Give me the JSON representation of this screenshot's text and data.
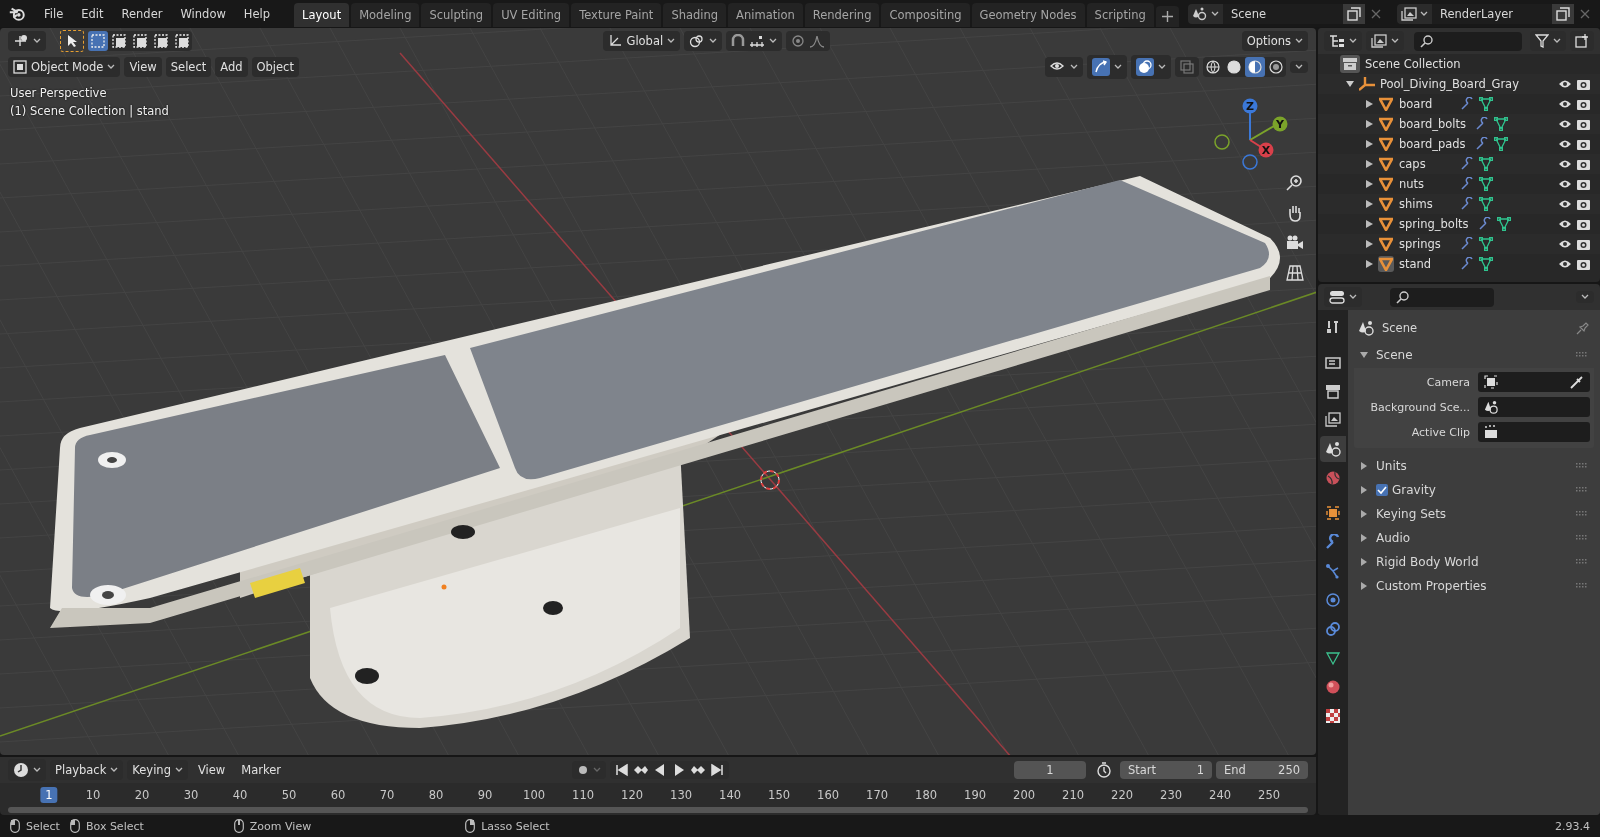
{
  "menu": [
    "File",
    "Edit",
    "Render",
    "Window",
    "Help"
  ],
  "workspaces": [
    {
      "label": "Layout",
      "selected": true
    },
    {
      "label": "Modeling",
      "selected": false
    },
    {
      "label": "Sculpting",
      "selected": false
    },
    {
      "label": "UV Editing",
      "selected": false
    },
    {
      "label": "Texture Paint",
      "selected": false
    },
    {
      "label": "Shading",
      "selected": false
    },
    {
      "label": "Animation",
      "selected": false
    },
    {
      "label": "Rendering",
      "selected": false
    },
    {
      "label": "Compositing",
      "selected": false
    },
    {
      "label": "Geometry Nodes",
      "selected": false
    },
    {
      "label": "Scripting",
      "selected": false
    }
  ],
  "scene": "Scene",
  "view_layer": "RenderLayer",
  "viewport": {
    "select_modes": [
      {
        "selected": true
      },
      {
        "selected": false
      },
      {
        "selected": false
      },
      {
        "selected": false
      },
      {
        "selected": false
      }
    ],
    "gizmos_on": true,
    "overlays_on": true,
    "orientation": "Global",
    "options": "Options",
    "mode": "Object Mode",
    "menus": [
      "View",
      "Select",
      "Add",
      "Object"
    ],
    "shading_modes": [
      {
        "selected": false
      },
      {
        "selected": false
      },
      {
        "selected": true
      },
      {
        "selected": false
      }
    ],
    "info": [
      "User Perspective",
      "(1) Scene Collection | stand"
    ],
    "axes": [
      "Z",
      "Y",
      "X"
    ]
  },
  "outliner": {
    "root": "Scene Collection",
    "collections": [
      {
        "name": "Pool_Diving_Board_Gray",
        "expanded": true,
        "children": [
          {
            "name": "board",
            "active": false
          },
          {
            "name": "board_bolts",
            "active": false
          },
          {
            "name": "board_pads",
            "active": false
          },
          {
            "name": "caps",
            "active": false
          },
          {
            "name": "nuts",
            "active": false
          },
          {
            "name": "shims",
            "active": false
          },
          {
            "name": "spring_bolts",
            "active": false
          },
          {
            "name": "springs",
            "active": false
          },
          {
            "name": "stand",
            "active": true
          }
        ]
      }
    ]
  },
  "properties": {
    "tabs": [
      {
        "kind": "tool",
        "selected": false
      },
      {
        "kind": "render",
        "selected": false
      },
      {
        "kind": "output",
        "selected": false
      },
      {
        "kind": "view_layer",
        "selected": false
      },
      {
        "kind": "scene",
        "selected": true
      },
      {
        "kind": "world",
        "selected": false
      },
      {
        "kind": "object",
        "selected": false
      },
      {
        "kind": "modifier",
        "selected": false
      },
      {
        "kind": "particles",
        "selected": false
      },
      {
        "kind": "physics",
        "selected": false
      },
      {
        "kind": "constraints",
        "selected": false
      },
      {
        "kind": "data",
        "selected": false
      },
      {
        "kind": "material",
        "selected": false
      },
      {
        "kind": "texture",
        "selected": false
      }
    ],
    "title": "Scene",
    "panel": {
      "title": "Scene",
      "expanded": true,
      "fields": [
        {
          "label": "Camera",
          "kind": "camera"
        },
        {
          "label": "Background Sce...",
          "kind": "scene"
        },
        {
          "label": "Active Clip",
          "kind": "clip"
        }
      ]
    },
    "subpanels": [
      {
        "title": "Units",
        "expanded": false
      },
      {
        "title": "Gravity",
        "expanded": false,
        "checked": true
      },
      {
        "title": "Keying Sets",
        "expanded": false
      },
      {
        "title": "Audio",
        "expanded": false
      },
      {
        "title": "Rigid Body World",
        "expanded": false
      },
      {
        "title": "Custom Properties",
        "expanded": false
      }
    ]
  },
  "timeline": {
    "menus": [
      "Playback",
      "Keying",
      "View",
      "Marker"
    ],
    "current_frame": "1",
    "start_label": "Start",
    "start": "1",
    "end_label": "End",
    "end": "250",
    "ticks": [
      {
        "label": "1",
        "selected": true
      },
      {
        "label": "10",
        "selected": false
      },
      {
        "label": "20",
        "selected": false
      },
      {
        "label": "30",
        "selected": false
      },
      {
        "label": "40",
        "selected": false
      },
      {
        "label": "50",
        "selected": false
      },
      {
        "label": "60",
        "selected": false
      },
      {
        "label": "70",
        "selected": false
      },
      {
        "label": "80",
        "selected": false
      },
      {
        "label": "90",
        "selected": false
      },
      {
        "label": "100",
        "selected": false
      },
      {
        "label": "110",
        "selected": false
      },
      {
        "label": "120",
        "selected": false
      },
      {
        "label": "130",
        "selected": false
      },
      {
        "label": "140",
        "selected": false
      },
      {
        "label": "150",
        "selected": false
      },
      {
        "label": "160",
        "selected": false
      },
      {
        "label": "170",
        "selected": false
      },
      {
        "label": "180",
        "selected": false
      },
      {
        "label": "190",
        "selected": false
      },
      {
        "label": "200",
        "selected": false
      },
      {
        "label": "210",
        "selected": false
      },
      {
        "label": "220",
        "selected": false
      },
      {
        "label": "230",
        "selected": false
      },
      {
        "label": "240",
        "selected": false
      },
      {
        "label": "250",
        "selected": false
      }
    ]
  },
  "status_bar": {
    "items": [
      "Select",
      "Box Select",
      "Zoom View",
      "Lasso Select"
    ],
    "version": "2.93.4"
  }
}
